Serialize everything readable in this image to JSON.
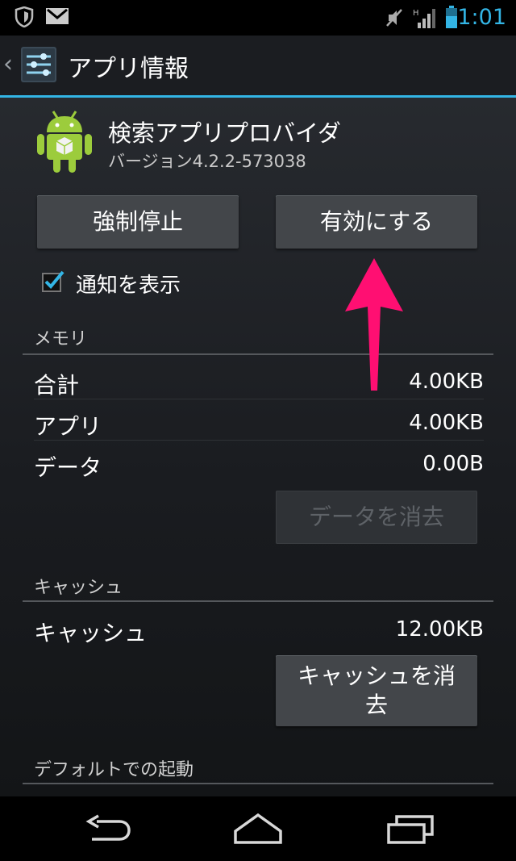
{
  "status_bar": {
    "time": "1:01",
    "icons": [
      "shield-icon",
      "gmail-icon",
      "mute-icon",
      "signal-icon",
      "battery-icon"
    ]
  },
  "action_bar": {
    "title": "アプリ情報",
    "back_icon": "chevron-left-icon",
    "app_icon": "settings-icon"
  },
  "app": {
    "name": "検索アプリプロバイダ",
    "version": "バージョン4.2.2-573038",
    "icon": "android-icon"
  },
  "buttons": {
    "force_stop": "強制停止",
    "enable": "有効にする",
    "clear_data": "データを消去",
    "clear_cache_line1": "キャッシュを消",
    "clear_cache_line2": "去"
  },
  "notification": {
    "label": "通知を表示",
    "checked": true
  },
  "storage": {
    "header": "メモリ",
    "rows": [
      {
        "label": "合計",
        "value": "4.00KB"
      },
      {
        "label": "アプリ",
        "value": "4.00KB"
      },
      {
        "label": "データ",
        "value": "0.00B"
      }
    ]
  },
  "cache": {
    "header": "キャッシュ",
    "row_label": "キャッシュ",
    "row_value": "12.00KB"
  },
  "launch_default": {
    "header": "デフォルトでの起動"
  },
  "colors": {
    "accent": "#33b5e5",
    "annotation_arrow": "#ff0f72"
  }
}
